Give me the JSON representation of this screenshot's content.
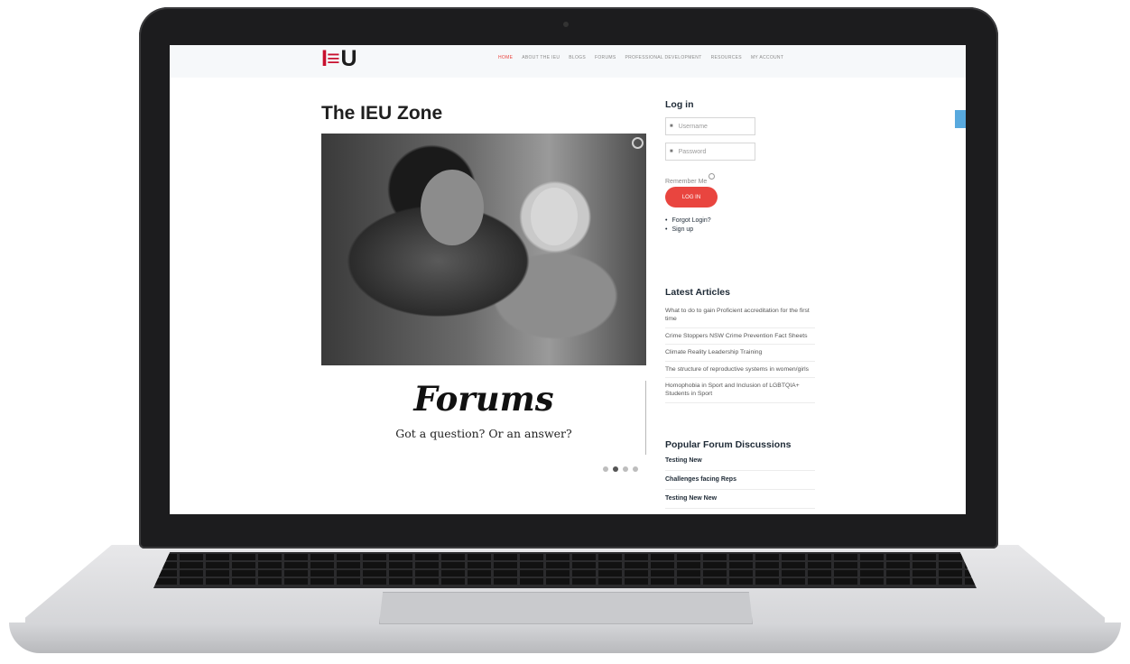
{
  "logo": {
    "letters_left": "I≡",
    "letters_right": "U"
  },
  "nav": {
    "items": [
      "HOME",
      "ABOUT THE IEU",
      "BLOGS",
      "FORUMS",
      "PROFESSIONAL DEVELOPMENT",
      "RESOURCES",
      "MY ACCOUNT"
    ],
    "active": "HOME"
  },
  "page": {
    "title": "The IEU Zone"
  },
  "slider": {
    "title": "Forums",
    "subtitle": "Got a question? Or an answer?",
    "active_slide": 2,
    "slide_count": 4
  },
  "login": {
    "heading": "Log in",
    "username_placeholder": "Username",
    "password_placeholder": "Password",
    "remember_label": "Remember Me",
    "button_label": "LOG IN",
    "forgot_label": "Forgot Login?",
    "signup_label": "Sign up"
  },
  "latest": {
    "heading": "Latest Articles",
    "articles": [
      "What to do to gain Proficient accreditation for the first time",
      "Crime Stoppers NSW Crime Prevention Fact Sheets",
      "Climate Reality Leadership Training",
      "The structure of reproductive systems in women/girls",
      "Homophobia in Sport and Inclusion of LGBTQIA+ Students in Sport"
    ]
  },
  "popular": {
    "heading": "Popular Forum Discussions",
    "items": [
      "Testing New",
      "Challenges facing Reps",
      "Testing New New"
    ]
  },
  "colors": {
    "accent": "#e9453f",
    "brand_red": "#c8102e",
    "twitter": "#58a9de"
  }
}
